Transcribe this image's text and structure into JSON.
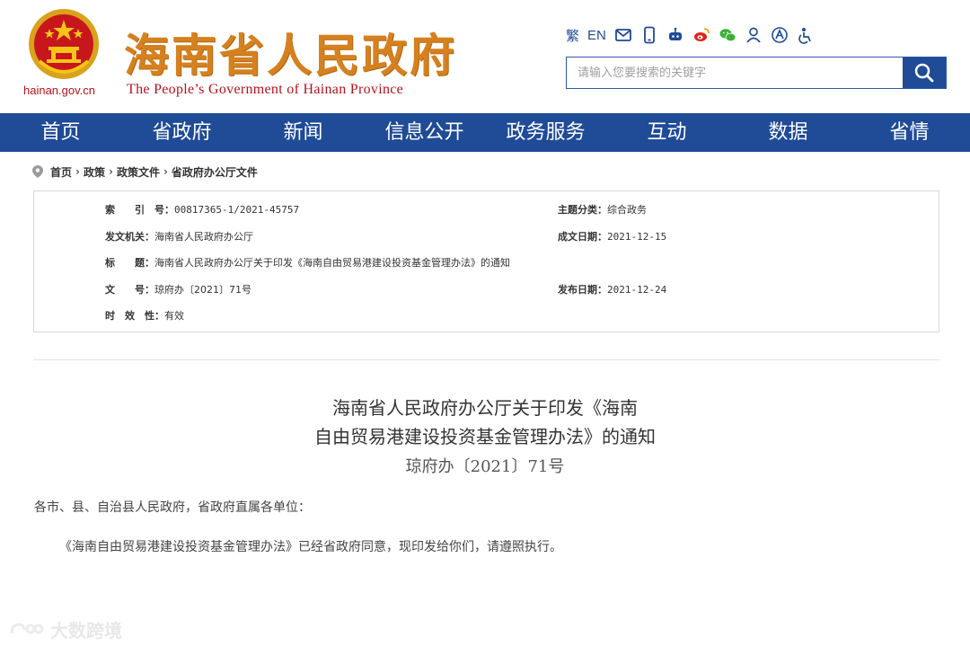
{
  "header": {
    "site_cn": "海南省人民政府",
    "site_en": "The People’s Government  of Hainan Province",
    "site_url": "hainan.gov.cn",
    "lang_trad": "繁",
    "lang_en": "EN",
    "tool_icons": [
      "mail-icon",
      "mobile-icon",
      "robot-icon",
      "weibo-icon",
      "wechat-icon",
      "user-icon",
      "accessibility-icon",
      "elderly-mode-icon"
    ],
    "search_placeholder": "请输入您要搜索的关键字",
    "brand_color": "#1f4b97"
  },
  "nav": {
    "items": [
      "首页",
      "省政府",
      "新闻",
      "信息公开",
      "政务服务",
      "互动",
      "数据",
      "省情"
    ]
  },
  "breadcrumb": [
    "首页",
    "政策",
    "政策文件",
    "省政府办公厅文件"
  ],
  "info": {
    "index_label": "索　　引　号：",
    "index_value": "00817365-1/2021-45757",
    "topic_label": "主题分类：",
    "topic_value": "综合政务",
    "issuer_label": "发文机关：",
    "issuer_value": "海南省人民政府办公厅",
    "date_label": "成文日期：",
    "date_value": "2021-12-15",
    "title_label": "标　　题：",
    "title_value": "海南省人民政府办公厅关于印发《海南自由贸易港建设投资基金管理办法》的通知",
    "docno_label": "文　　号：",
    "docno_value": "琼府办〔2021〕71号",
    "publish_label": "发布日期：",
    "publish_value": "2021-12-24",
    "validity_label": "时　效　性：",
    "validity_value": "有效"
  },
  "document": {
    "title_line1": "海南省人民政府办公厅关于印发《海南",
    "title_line2": "自由贸易港建设投资基金管理办法》的通知",
    "doc_number": "琼府办〔2021〕71号",
    "salutation": "各市、县、自治县人民政府，省政府直属各单位：",
    "body": "《海南自由贸易港建设投资基金管理办法》已经省政府同意，现印发给你们，请遵照执行。"
  },
  "watermark": "大数跨境"
}
